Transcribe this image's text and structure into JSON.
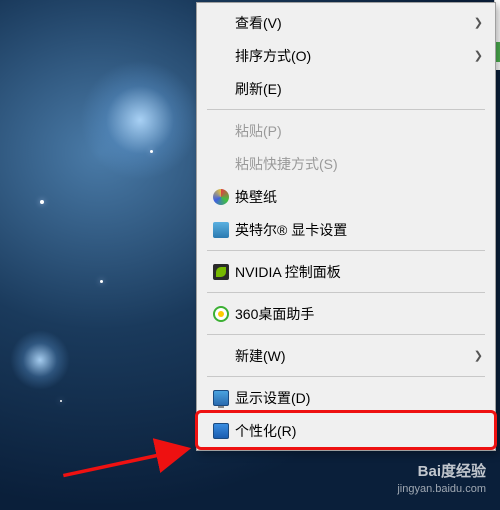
{
  "menu": {
    "items": [
      {
        "label": "查看(V)",
        "submenu": true
      },
      {
        "label": "排序方式(O)",
        "submenu": true
      },
      {
        "label": "刷新(E)"
      },
      {
        "sep": true
      },
      {
        "label": "粘贴(P)",
        "disabled": true
      },
      {
        "label": "粘贴快捷方式(S)",
        "disabled": true
      },
      {
        "icon": "wallpaper-icon",
        "label": "换壁纸"
      },
      {
        "icon": "intel-icon",
        "label": "英特尔® 显卡设置"
      },
      {
        "sep": true
      },
      {
        "icon": "nvidia-icon",
        "label": "NVIDIA 控制面板"
      },
      {
        "sep": true
      },
      {
        "icon": "360-icon",
        "label": "360桌面助手"
      },
      {
        "sep": true
      },
      {
        "label": "新建(W)",
        "submenu": true
      },
      {
        "sep": true
      },
      {
        "icon": "display-icon",
        "label": "显示设置(D)"
      },
      {
        "icon": "personalize-icon",
        "label": "个性化(R)",
        "highlighted": true
      }
    ]
  },
  "watermark": {
    "brand": "Bai度经验",
    "url": "jingyan.baidu.com"
  }
}
